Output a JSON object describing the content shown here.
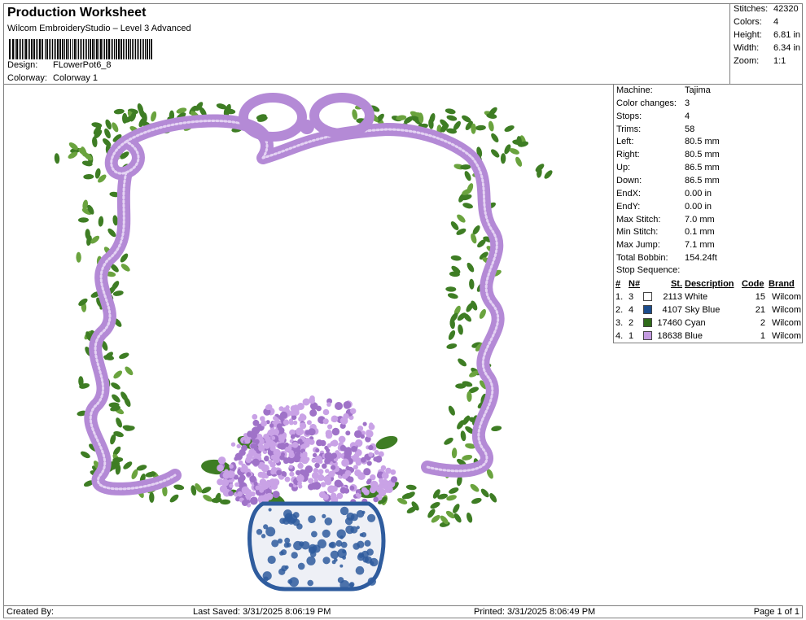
{
  "header": {
    "title": "Production Worksheet",
    "subtitle": "Wilcom EmbroideryStudio – Level 3 Advanced",
    "design_label": "Design:",
    "design_value": "FLowerPot6_8",
    "colorway_label": "Colorway:",
    "colorway_value": "Colorway 1"
  },
  "summary": {
    "stitches_label": "Stitches:",
    "stitches_value": "42320",
    "colors_label": "Colors:",
    "colors_value": "4",
    "height_label": "Height:",
    "height_value": "6.81 in",
    "width_label": "Width:",
    "width_value": "6.34 in",
    "zoom_label": "Zoom:",
    "zoom_value": "1:1"
  },
  "machine_info": [
    {
      "label": "Machine:",
      "value": "Tajima"
    },
    {
      "label": "Color changes:",
      "value": "3"
    },
    {
      "label": "Stops:",
      "value": "4"
    },
    {
      "label": "Trims:",
      "value": "58"
    },
    {
      "label": "Left:",
      "value": "80.5 mm"
    },
    {
      "label": "Right:",
      "value": "80.5 mm"
    },
    {
      "label": "Up:",
      "value": "86.5 mm"
    },
    {
      "label": "Down:",
      "value": "86.5 mm"
    },
    {
      "label": "EndX:",
      "value": "0.00 in"
    },
    {
      "label": "EndY:",
      "value": "0.00 in"
    },
    {
      "label": "Max Stitch:",
      "value": "7.0 mm"
    },
    {
      "label": "Min Stitch:",
      "value": "0.1 mm"
    },
    {
      "label": "Max Jump:",
      "value": "7.1 mm"
    },
    {
      "label": "Total Bobbin:",
      "value": "154.24ft"
    }
  ],
  "stop_sequence": {
    "title": "Stop Sequence:",
    "headers": {
      "num": "#",
      "n": "N#",
      "st": "St.",
      "description": "Description",
      "code": "Code",
      "brand": "Brand"
    },
    "rows": [
      {
        "num": "1.",
        "n": "3",
        "color": "#ffffff",
        "st": "2113",
        "description": "White",
        "code": "15",
        "brand": "Wilcom"
      },
      {
        "num": "2.",
        "n": "4",
        "color": "#1c4c8c",
        "st": "4107",
        "description": "Sky Blue",
        "code": "21",
        "brand": "Wilcom"
      },
      {
        "num": "3.",
        "n": "2",
        "color": "#2f6b1a",
        "st": "17460",
        "description": "Cyan",
        "code": "2",
        "brand": "Wilcom"
      },
      {
        "num": "4.",
        "n": "1",
        "color": "#c49be0",
        "st": "18638",
        "description": "Blue",
        "code": "1",
        "brand": "Wilcom"
      }
    ]
  },
  "footer": {
    "created_by": "Created By:",
    "last_saved": "Last Saved: 3/31/2025 8:06:19 PM",
    "printed": "Printed: 3/31/2025 8:06:49 PM",
    "page": "Page 1 of 1"
  },
  "design_colors": {
    "ribbon": "#b48ad6",
    "ribbon_stripe": "#e4d3f3",
    "leaf": "#3e7d24",
    "leaf_light": "#6aa33e",
    "flower": "#c9a2e6",
    "flower_dark": "#9f72c8",
    "vase_blue": "#2f5c9e",
    "vase_white": "#eef0f6"
  }
}
